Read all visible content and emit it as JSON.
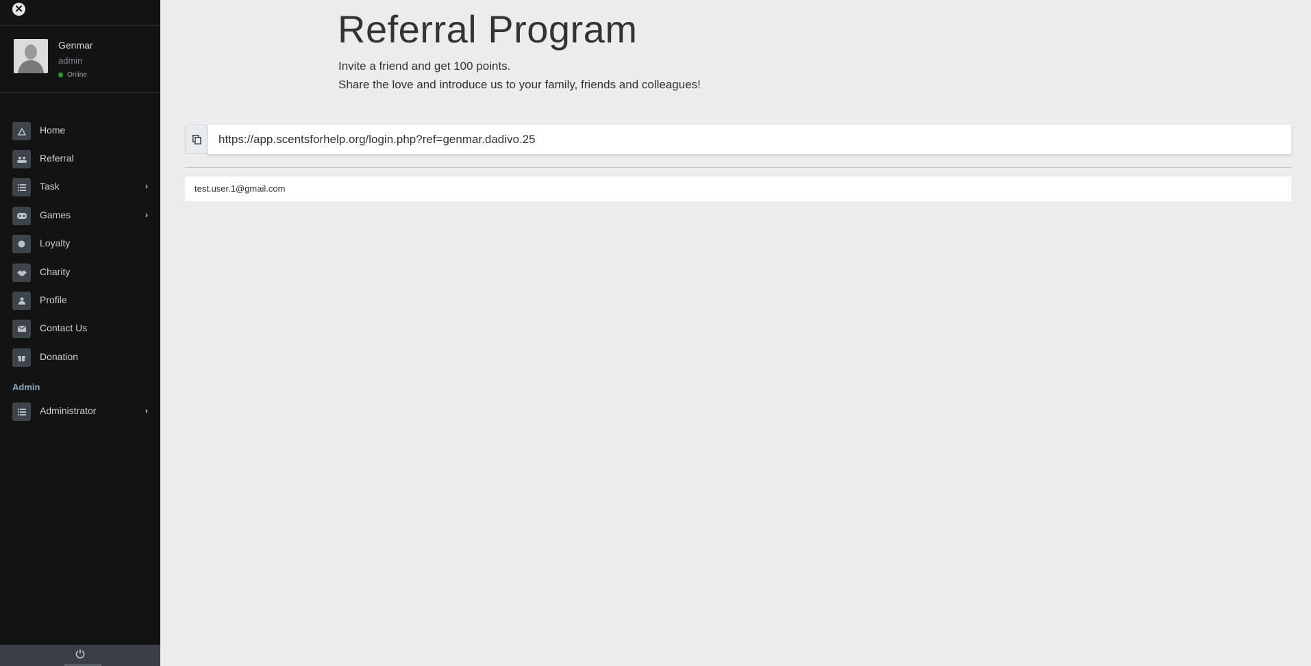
{
  "sidebar": {
    "close_icon": "times-circle-icon",
    "user": {
      "name": "Genmar",
      "role": "admin",
      "status": "Online",
      "status_color": "#1fa52f"
    },
    "nav": [
      {
        "label": "Home",
        "icon": "dashboard-icon",
        "has_submenu": false
      },
      {
        "label": "Referral",
        "icon": "users-icon",
        "has_submenu": false
      },
      {
        "label": "Task",
        "icon": "tasks-icon",
        "has_submenu": true
      },
      {
        "label": "Games",
        "icon": "gamepad-icon",
        "has_submenu": true
      },
      {
        "label": "Loyalty",
        "icon": "badge-icon",
        "has_submenu": false
      },
      {
        "label": "Charity",
        "icon": "handshake-icon",
        "has_submenu": false
      },
      {
        "label": "Profile",
        "icon": "user-icon",
        "has_submenu": false
      },
      {
        "label": "Contact Us",
        "icon": "envelope-icon",
        "has_submenu": false
      },
      {
        "label": "Donation",
        "icon": "gift-icon",
        "has_submenu": false
      }
    ],
    "admin_section": {
      "header": "Admin",
      "items": [
        {
          "label": "Administrator",
          "icon": "tasks-icon",
          "has_submenu": true
        }
      ]
    },
    "footer_icon": "power-icon"
  },
  "main": {
    "title": "Referral Program",
    "subtitle_line1": "Invite a friend and get 100 points.",
    "subtitle_line2": "Share the love and introduce us to your family, friends and colleagues!",
    "referral_url": "https://app.scentsforhelp.org/login.php?ref=genmar.dadivo.25",
    "copy_icon": "copy-icon",
    "referrals": [
      "test.user.1@gmail.com"
    ]
  }
}
